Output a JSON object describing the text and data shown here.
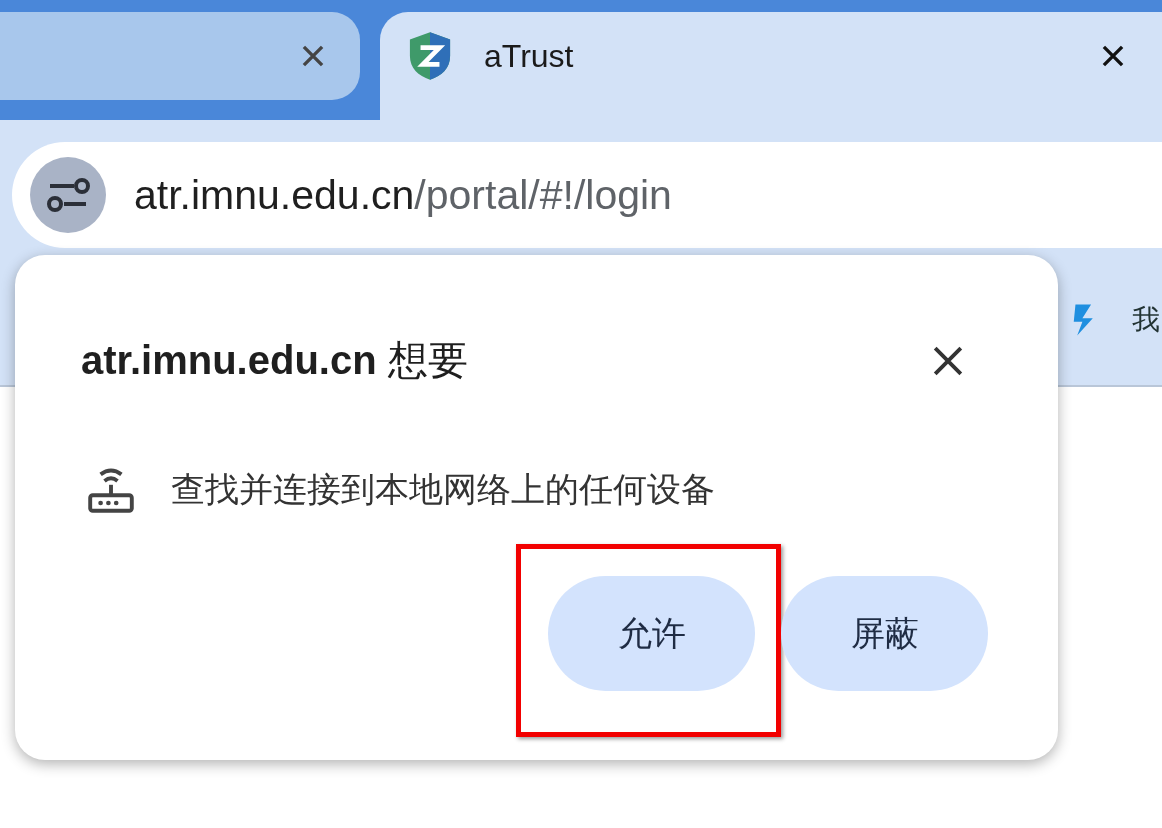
{
  "tabs": [
    {
      "selected": false
    },
    {
      "title": "aTrust",
      "selected": true
    }
  ],
  "address_bar": {
    "host": "atr.imnu.edu.cn",
    "path": "/portal/#!/login"
  },
  "bookmarks": [
    {
      "label": "我",
      "kind": "logo"
    }
  ],
  "dialog": {
    "title_host": "atr.imnu.edu.cn",
    "title_suffix": "想要",
    "permission": "查找并连接到本地网络上的任何设备",
    "buttons": [
      {
        "label": "允许",
        "highlighted": true
      },
      {
        "label": "屏蔽",
        "highlighted": false
      }
    ]
  }
}
